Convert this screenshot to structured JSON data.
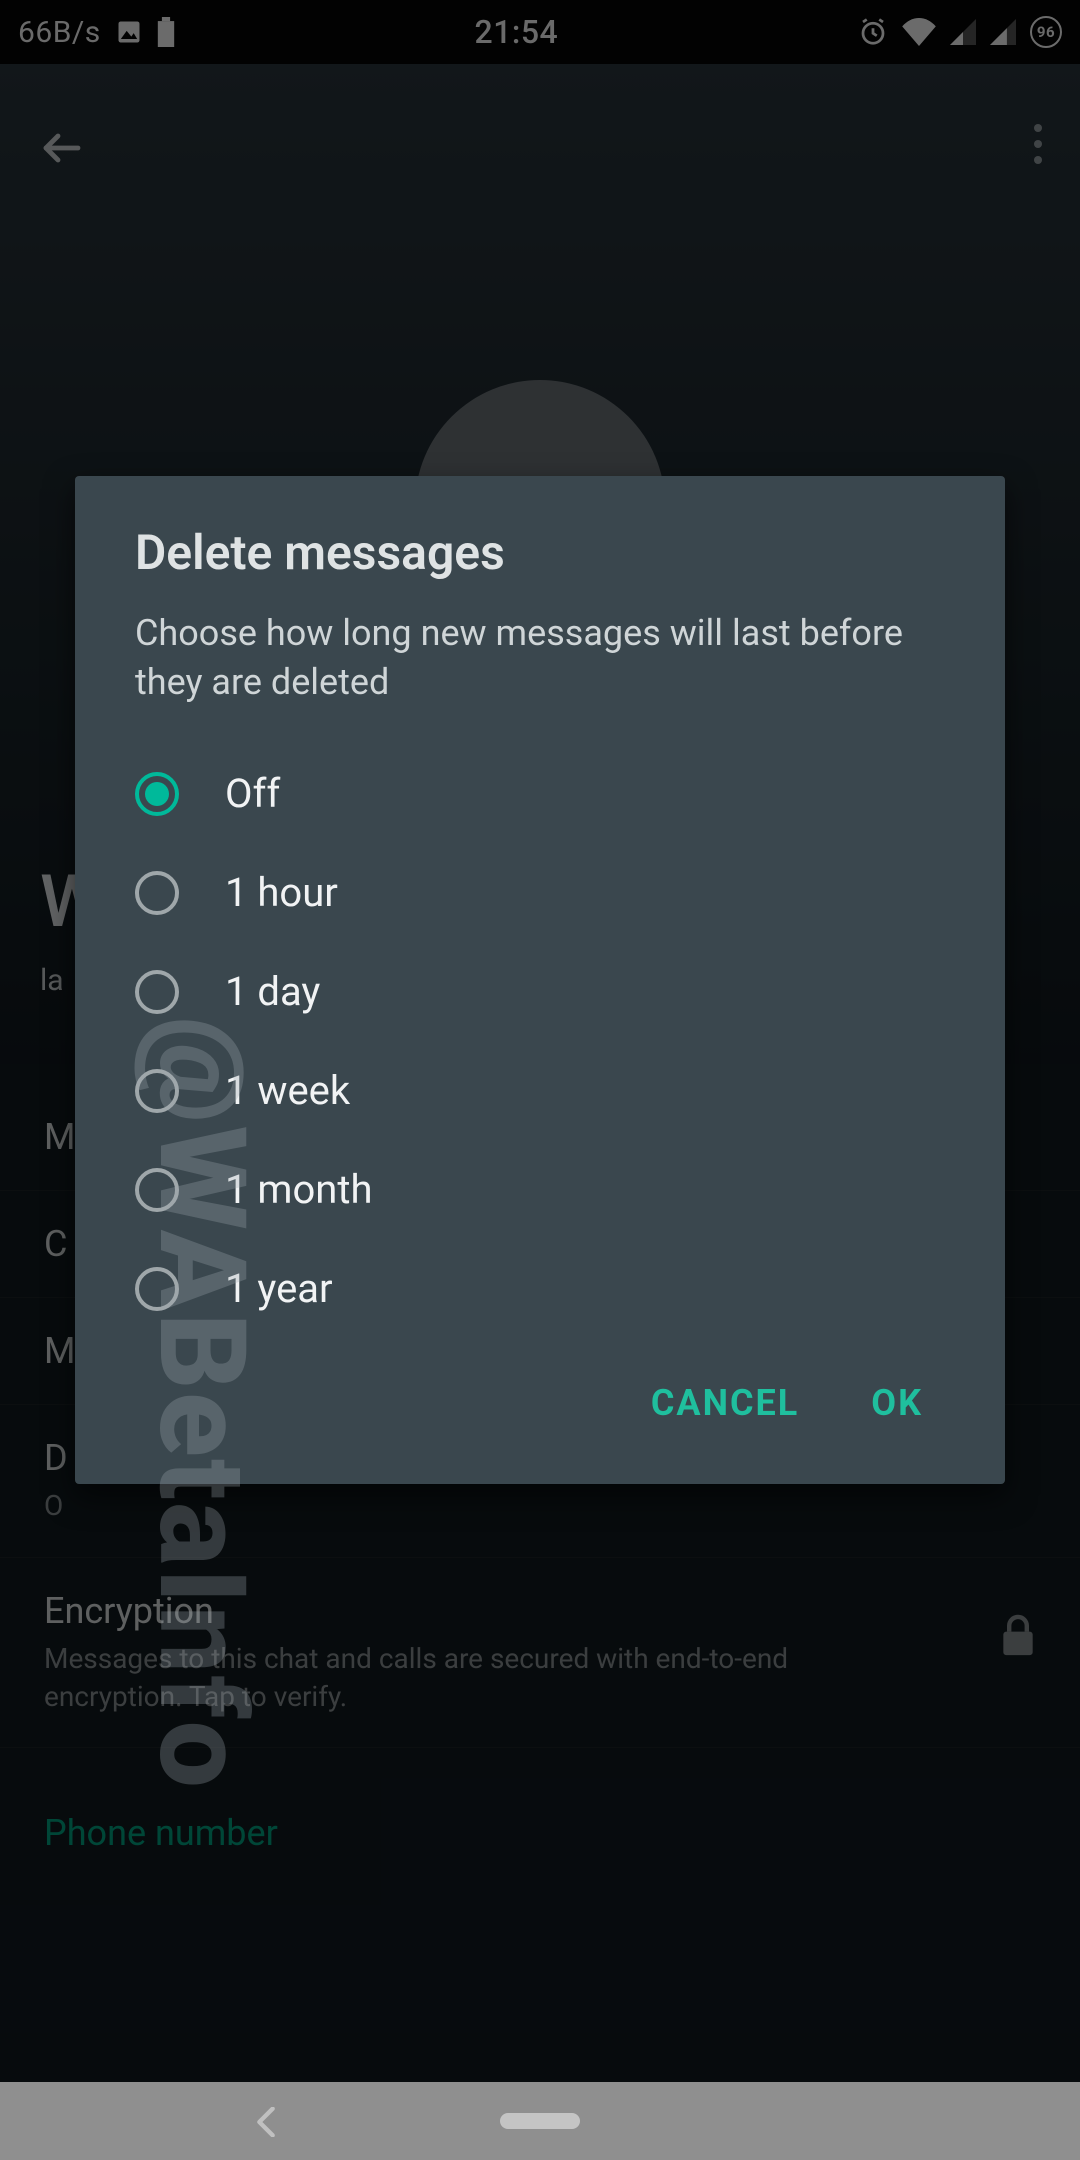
{
  "status": {
    "speed": "66B/s",
    "time": "21:54",
    "badge": "96"
  },
  "bg": {
    "name_truncated": "W",
    "last_truncated": "la",
    "rows": {
      "m1": "M",
      "c1": "C",
      "m2": "M",
      "d_title": "D",
      "d_sub": "O",
      "enc_title": "Encryption",
      "enc_sub": "Messages to this chat and calls are secured with end-to-end encryption. Tap to verify."
    },
    "phone_section": "Phone number"
  },
  "dialog": {
    "title": "Delete messages",
    "description": "Choose how long new messages will last before they are deleted",
    "options": [
      {
        "label": "Off",
        "selected": true
      },
      {
        "label": "1 hour",
        "selected": false
      },
      {
        "label": "1 day",
        "selected": false
      },
      {
        "label": "1 week",
        "selected": false
      },
      {
        "label": "1 month",
        "selected": false
      },
      {
        "label": "1 year",
        "selected": false
      }
    ],
    "cancel": "CANCEL",
    "ok": "OK"
  },
  "watermark": "@WABetaInfo"
}
